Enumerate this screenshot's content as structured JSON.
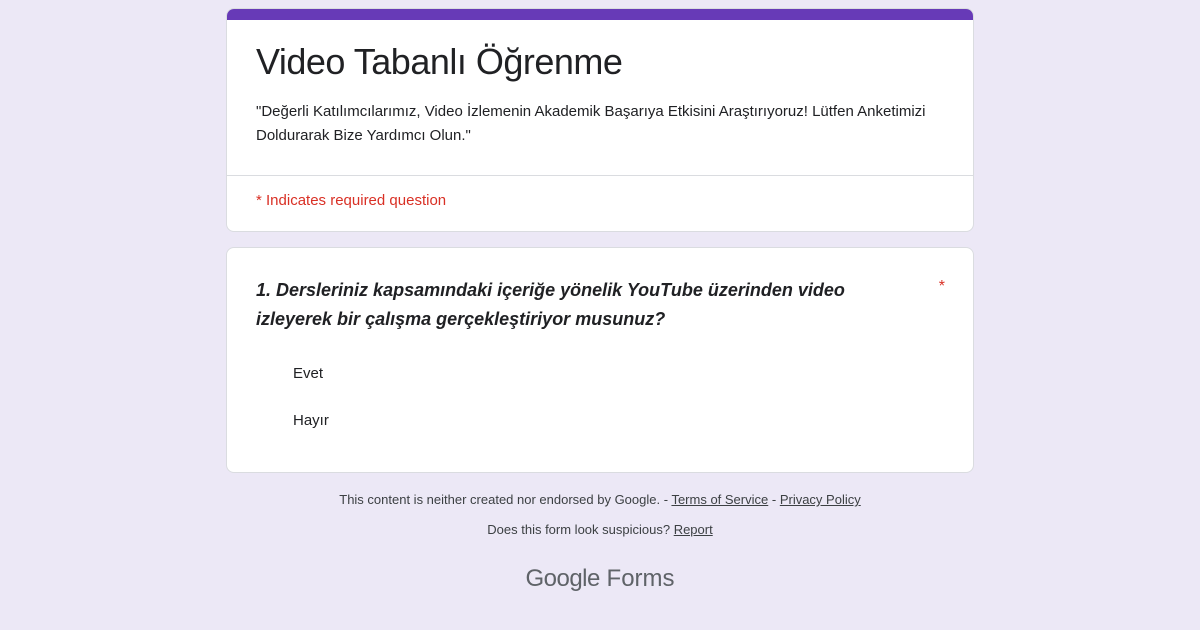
{
  "form": {
    "title": "Video Tabanlı Öğrenme",
    "description": "\"Değerli Katılımcılarımız, Video İzlemenin Akademik Başarıya Etkisini Araştırıyoruz! Lütfen Anketimizi Doldurarak Bize Yardımcı Olun.\"",
    "required_note": "* Indicates required question",
    "accent_color": "#673ab7",
    "required_color": "#d93025"
  },
  "question": {
    "text": "1. Dersleriniz kapsamındaki içeriğe yönelik YouTube üzerinden video izleyerek bir çalışma gerçekleştiriyor musunuz?",
    "required_marker": "*",
    "options": [
      {
        "label": "Evet"
      },
      {
        "label": "Hayır"
      }
    ]
  },
  "footer": {
    "disclaimer": "This content is neither created nor endorsed by Google. - ",
    "terms_label": "Terms of Service",
    "separator": " - ",
    "privacy_label": "Privacy Policy",
    "suspicious_text": "Does this form look suspicious? ",
    "report_label": "Report",
    "brand_google": "Google",
    "brand_forms": "Forms"
  }
}
